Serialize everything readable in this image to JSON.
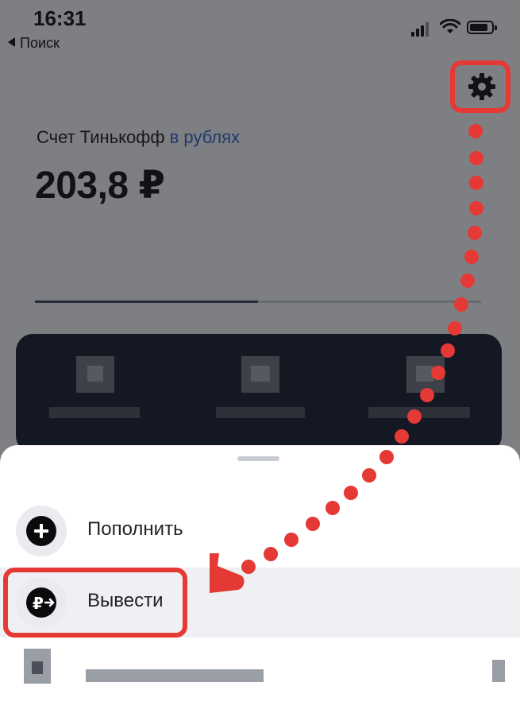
{
  "status_bar": {
    "time": "16:31",
    "back_label": "Поиск"
  },
  "account": {
    "title": "Счет Тинькофф",
    "currency_label": "в рублях",
    "balance": "203,8 ₽",
    "progress": 0.5
  },
  "menu": {
    "items": [
      {
        "label": "Пополнить",
        "icon": "plus-icon"
      },
      {
        "label": "Вывести",
        "icon": "ruble-withdraw-icon",
        "highlighted": true
      }
    ]
  },
  "annotation": {
    "color": "#e53935"
  },
  "colors": {
    "accent_blue": "#2f5fb8",
    "card_bg": "#141c2c"
  }
}
